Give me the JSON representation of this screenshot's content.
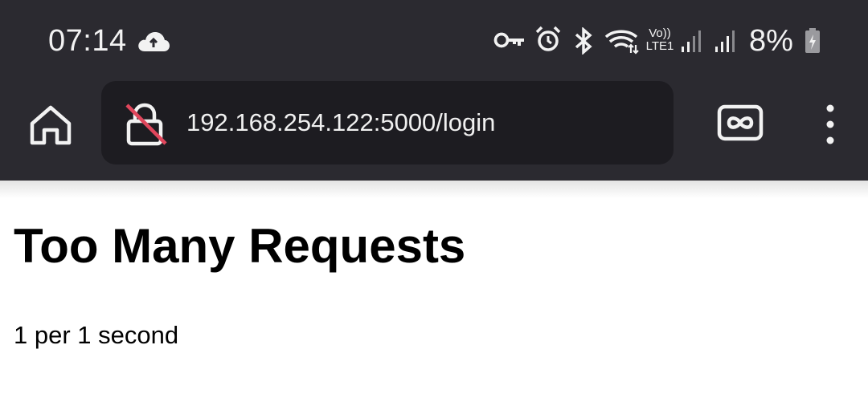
{
  "status_bar": {
    "time": "07:14",
    "network_label_top": "Vo))",
    "network_label_bottom": "LTE1",
    "battery_percent": "8%",
    "icons": [
      "cloud-upload-icon",
      "vpn-key-icon",
      "alarm-icon",
      "bluetooth-icon",
      "wifi-icon",
      "volte-icon",
      "signal-icon",
      "signal-icon",
      "battery-charging-icon"
    ]
  },
  "browser": {
    "url": "192.168.254.122:5000/login",
    "connection_state": "not-secure",
    "icons": [
      "home-icon",
      "lock-slashed-icon",
      "reader-mode-icon",
      "more-vert-icon"
    ]
  },
  "page": {
    "title": "Too Many Requests",
    "message": "1 per 1 second"
  }
}
